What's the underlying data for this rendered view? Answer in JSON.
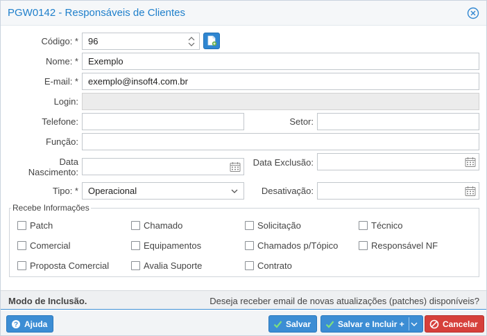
{
  "window": {
    "title": "PGW0142 - Responsáveis de Clientes"
  },
  "form": {
    "codigo": {
      "label": "Código: *",
      "value": "96"
    },
    "nome": {
      "label": "Nome: *",
      "value": "Exemplo"
    },
    "email": {
      "label": "E-mail: *",
      "value": "exemplo@insoft4.com.br"
    },
    "login": {
      "label": "Login:",
      "value": ""
    },
    "telefone": {
      "label": "Telefone:",
      "value": ""
    },
    "setor": {
      "label": "Setor:",
      "value": ""
    },
    "funcao": {
      "label": "Função:",
      "value": ""
    },
    "data_nascimento": {
      "label_line1": "Data",
      "label_line2": "Nascimento:",
      "value": ""
    },
    "data_exclusao": {
      "label": "Data Exclusão:",
      "value": ""
    },
    "tipo": {
      "label": "Tipo: *",
      "value": "Operacional"
    },
    "desativacao": {
      "label": "Desativação:",
      "value": ""
    }
  },
  "recebe": {
    "legend": "Recebe Informações",
    "options": [
      "Patch",
      "Chamado",
      "Solicitação",
      "Técnico",
      "Comercial",
      "Equipamentos",
      "Chamados p/Tópico",
      "Responsável NF",
      "Proposta Comercial",
      "Avalia Suporte",
      "Contrato"
    ]
  },
  "status": {
    "mode": "Modo de Inclusão.",
    "question": "Deseja receber email de novas atualizações (patches) disponíveis?"
  },
  "buttons": {
    "help": "Ajuda",
    "save": "Salvar",
    "save_include": "Salvar e Incluir +",
    "cancel": "Cancelar"
  },
  "colors": {
    "accent": "#1e7fcb",
    "save": "#2f9a4a",
    "cancel": "#d6403b",
    "help": "#3c8dd4"
  }
}
